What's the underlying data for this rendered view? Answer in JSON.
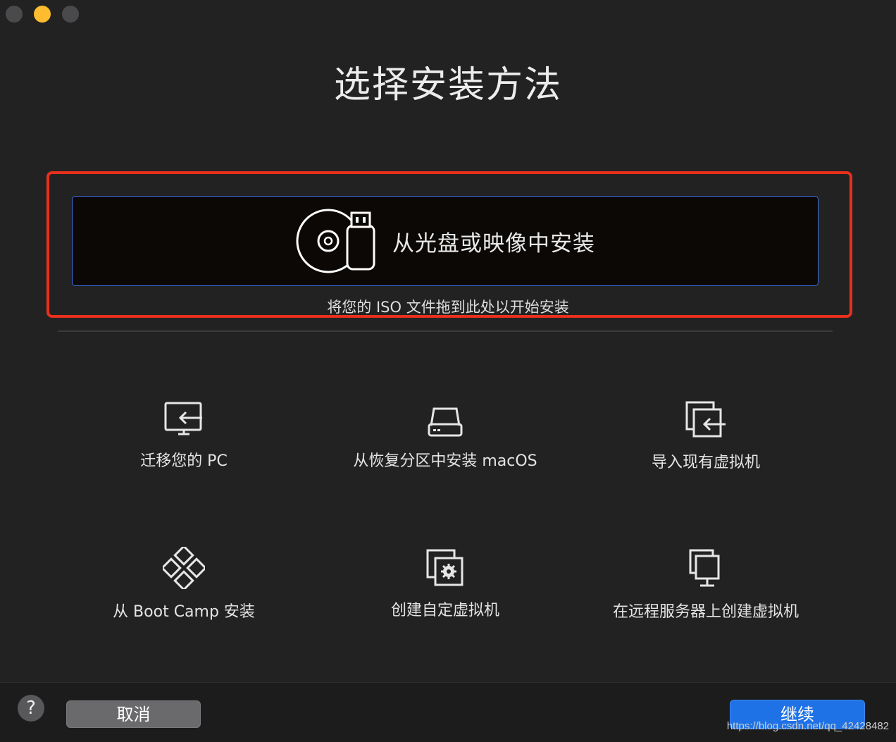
{
  "window": {
    "traffic_lights": [
      "close",
      "minimize",
      "maximize"
    ]
  },
  "title": "选择安装方法",
  "dropzone": {
    "label": "从光盘或映像中安装",
    "hint": "将您的 ISO 文件拖到此处以开始安装",
    "icon": "disc-usb-icon"
  },
  "options": [
    {
      "label": "迁移您的 PC",
      "icon": "migrate-pc-icon"
    },
    {
      "label": "从恢复分区中安装 macOS",
      "icon": "recovery-drive-icon"
    },
    {
      "label": "导入现有虚拟机",
      "icon": "import-vm-icon"
    },
    {
      "label": "从 Boot Camp 安装",
      "icon": "boot-camp-icon"
    },
    {
      "label": "创建自定虚拟机",
      "icon": "custom-vm-icon"
    },
    {
      "label": "在远程服务器上创建虚拟机",
      "icon": "remote-server-icon"
    }
  ],
  "footer": {
    "help": "?",
    "cancel": "取消",
    "continue": "继续",
    "watermark": "https://blog.csdn.net/qq_42428482"
  },
  "colors": {
    "accent": "#1f72e6",
    "highlight": "#e8301c",
    "background": "#222223"
  }
}
